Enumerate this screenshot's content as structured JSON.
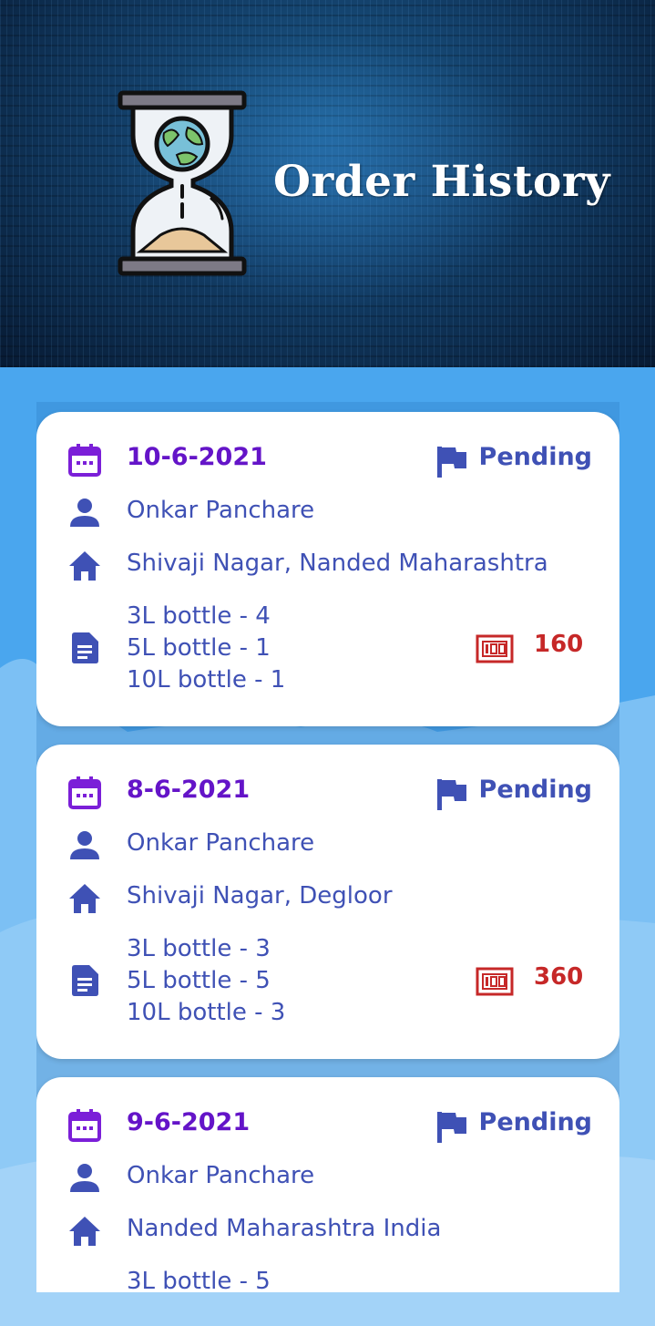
{
  "header": {
    "title": "Order History"
  },
  "colors": {
    "date": "#6414c8",
    "text": "#3f51b5",
    "total": "#c62828",
    "background": "#4aa6ee"
  },
  "orders": [
    {
      "date": "10-6-2021",
      "status": "Pending",
      "name": "Onkar Panchare",
      "address": "Shivaji Nagar, Nanded Maharashtra",
      "items": [
        "3L bottle - 4",
        "5L bottle - 1",
        "10L bottle - 1"
      ],
      "total": "160"
    },
    {
      "date": "8-6-2021",
      "status": "Pending",
      "name": "Onkar Panchare",
      "address": "Shivaji Nagar, Degloor",
      "items": [
        "3L bottle - 3",
        "5L bottle - 5",
        "10L bottle - 3"
      ],
      "total": "360"
    },
    {
      "date": "9-6-2021",
      "status": "Pending",
      "name": "Onkar Panchare",
      "address": "Nanded Maharashtra India",
      "items": [
        "3L bottle - 5"
      ],
      "total": ""
    }
  ],
  "icons": {
    "date": "calendar-icon",
    "status": "flag-icon",
    "name": "person-icon",
    "address": "home-icon",
    "items": "document-icon",
    "total": "cash-icon",
    "logo": "hourglass-globe-icon"
  }
}
